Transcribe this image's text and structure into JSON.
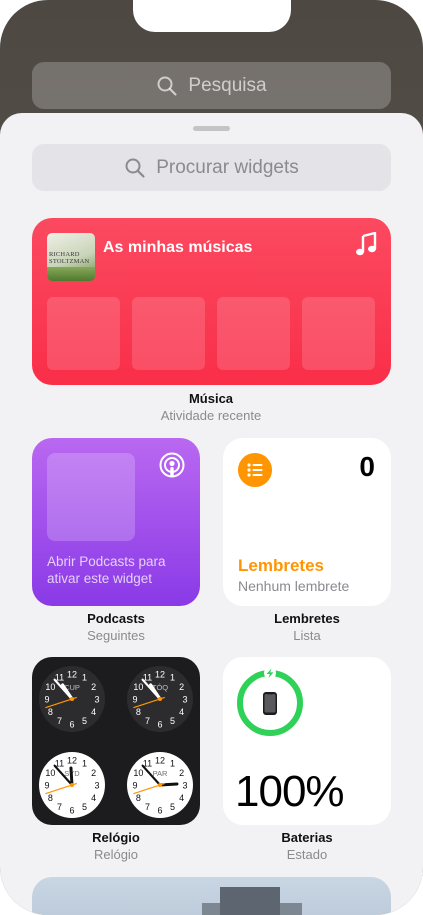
{
  "top_search": {
    "placeholder": "Pesquisa",
    "icon": "search-icon"
  },
  "widget_search": {
    "placeholder": "Procurar widgets",
    "icon": "search-icon"
  },
  "music": {
    "title": "As minhas músicas",
    "album_art_text": [
      "RICHARD",
      "STOLTZMAN"
    ],
    "label": "Música",
    "sublabel": "Atividade recente",
    "color": "#fa2e49"
  },
  "podcasts": {
    "text": "Abrir Podcasts para ativar este widget",
    "label": "Podcasts",
    "sublabel": "Seguintes",
    "color": "#a354ee"
  },
  "reminders": {
    "count": "0",
    "title": "Lembretes",
    "subtitle": "Nenhum lembrete",
    "label": "Lembretes",
    "sublabel": "Lista",
    "color": "#ff9500"
  },
  "clock": {
    "label": "Relógio",
    "sublabel": "Relógio",
    "faces": [
      {
        "city": "CUP",
        "dark": true,
        "hour": 10,
        "minute": 53,
        "second": 42
      },
      {
        "city": "TÓQ",
        "dark": true,
        "hour": 10,
        "minute": 53,
        "second": 42
      },
      {
        "city": "SYD",
        "dark": false,
        "hour": 11,
        "minute": 53,
        "second": 42
      },
      {
        "city": "PAR",
        "dark": false,
        "hour": 2,
        "minute": 53,
        "second": 42
      }
    ]
  },
  "battery": {
    "percent": "100%",
    "level": 1.0,
    "label": "Baterias",
    "sublabel": "Estado",
    "color": "#30d158"
  }
}
